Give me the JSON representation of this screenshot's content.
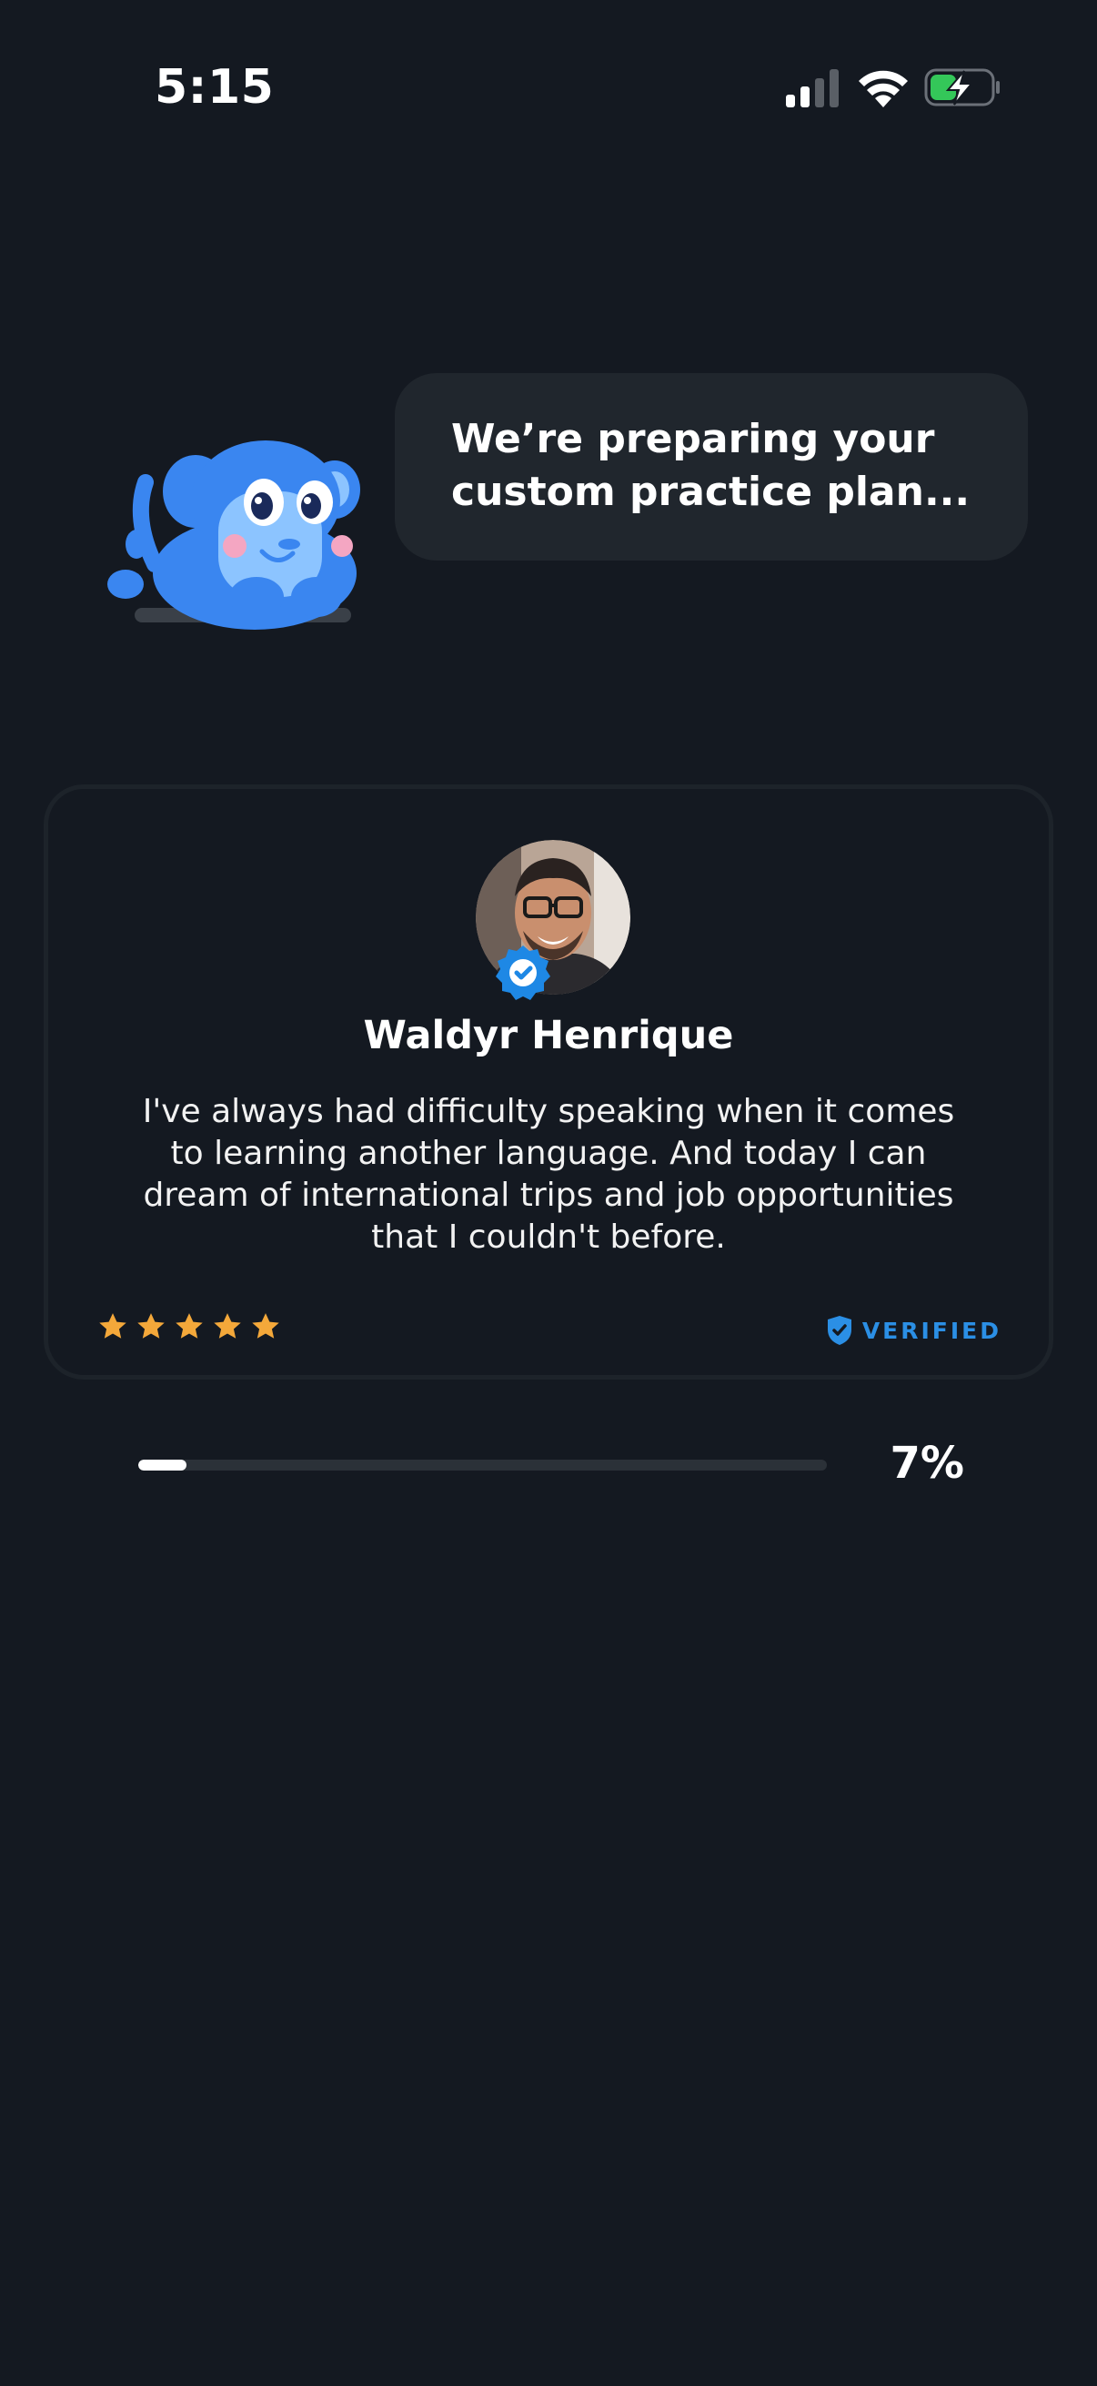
{
  "status_bar": {
    "time": "5:15",
    "signal_icon": "cellular-signal-icon",
    "wifi_icon": "wifi-icon",
    "battery_icon": "battery-charging-icon"
  },
  "mascot": {
    "icon": "monkey-mascot"
  },
  "speech_bubble": {
    "text": "We’re preparing your custom practice plan..."
  },
  "testimonial": {
    "reviewer_name": "Waldyr Henrique",
    "quote": "I've always had difficulty speaking when it comes to learning another language. And today I can dream of international trips and job opportunities that I couldn't before.",
    "rating": 5,
    "rating_max": 5,
    "verified_label": "VERIFIED",
    "star_color": "#f4a83a",
    "verified_color": "#2b8fe5"
  },
  "progress": {
    "value": 0.07,
    "label": "7%"
  }
}
